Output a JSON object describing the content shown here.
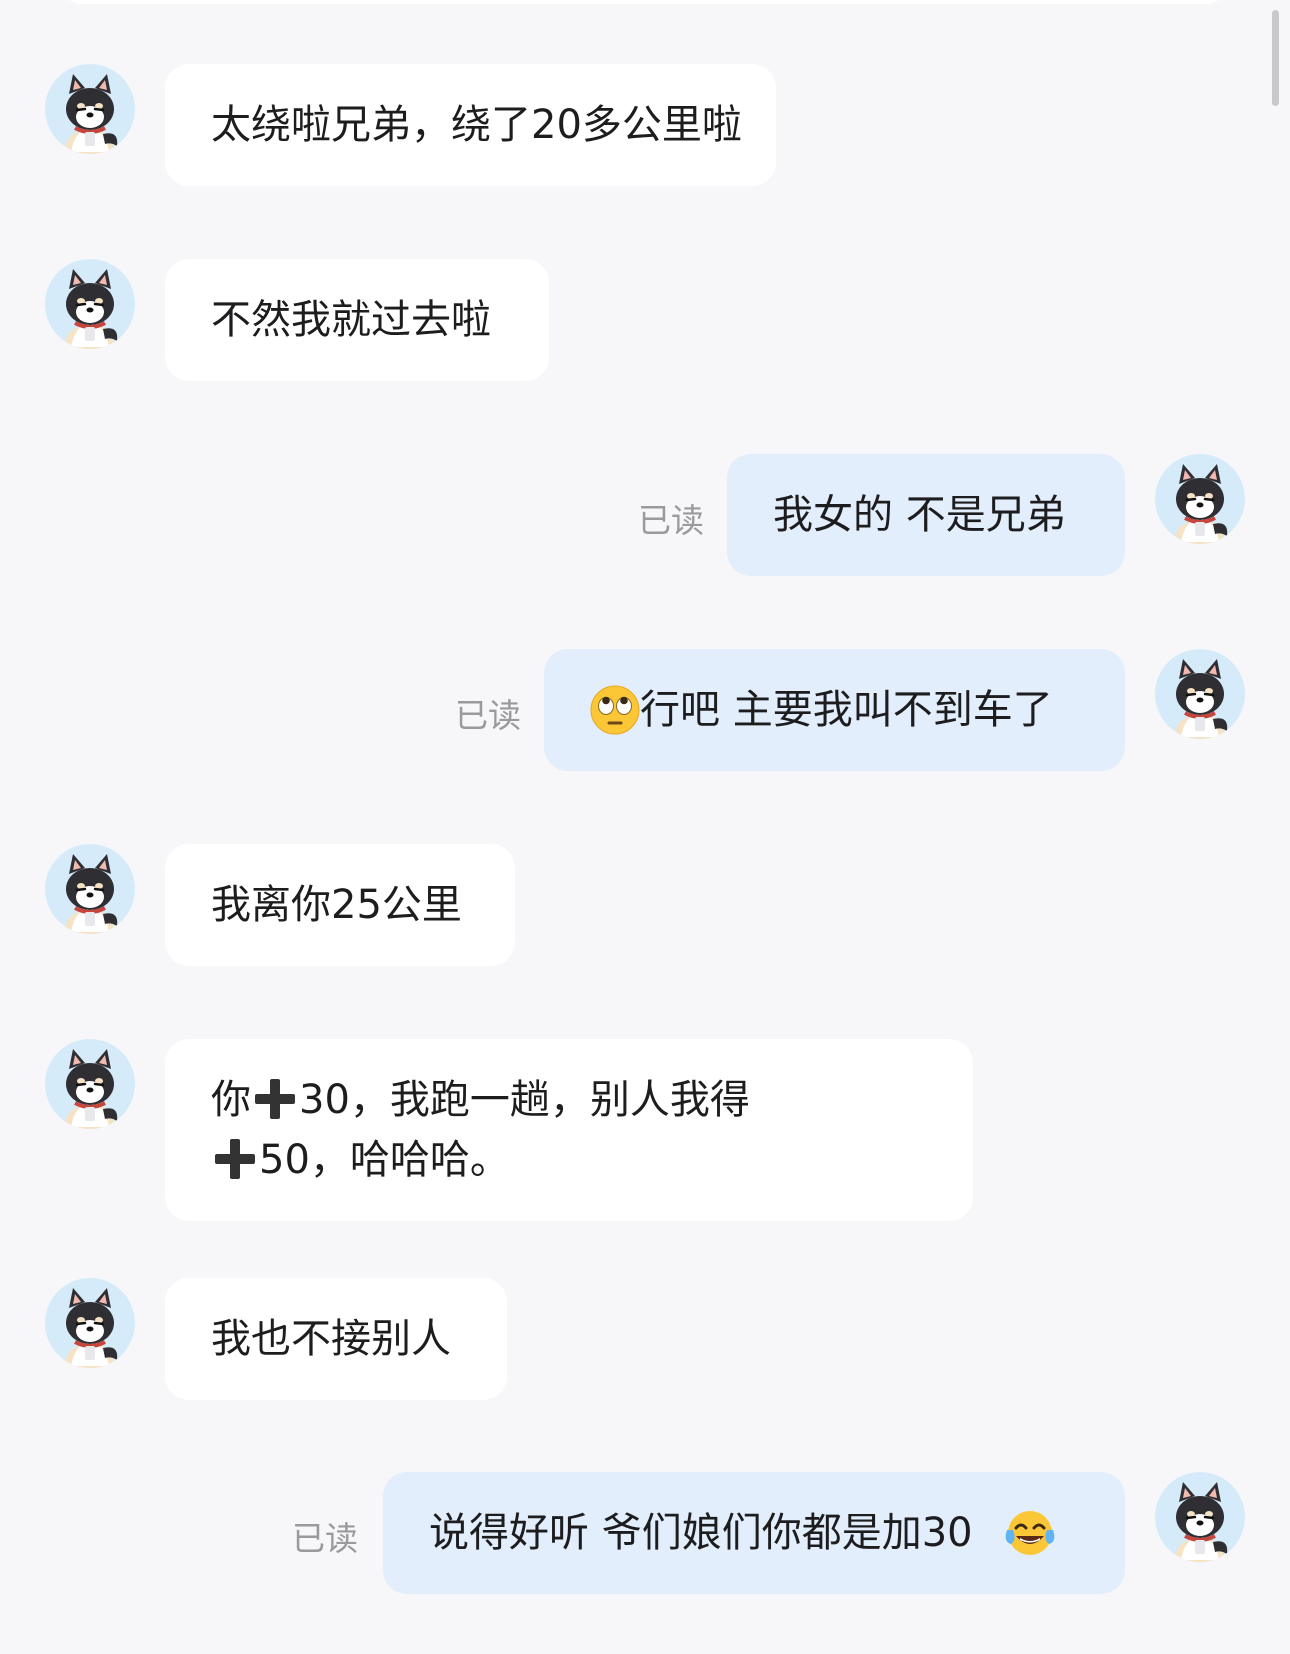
{
  "messages": [
    {
      "side": "left",
      "text": "太绕啦兄弟，绕了20多公里啦"
    },
    {
      "side": "left",
      "text": "不然我就过去啦"
    },
    {
      "side": "right",
      "text": "我女的 不是兄弟",
      "status": "已读"
    },
    {
      "side": "right",
      "text": "行吧 主要我叫不到车了",
      "status": "已读",
      "emoji": "eye-roll-emoji"
    },
    {
      "side": "left",
      "text": "我离你25公里"
    },
    {
      "side": "left",
      "line1a": "你",
      "line1b": "30，我跑一趟，别人我得",
      "line2": "50，哈哈哈。"
    },
    {
      "side": "left",
      "text": "我也不接别人"
    },
    {
      "side": "right",
      "text": "说得好听 爷们娘们你都是加30",
      "status": "已读",
      "emoji": "tears-of-joy-emoji"
    }
  ],
  "colors": {
    "background": "#f7f7f9",
    "incoming_bubble": "#ffffff",
    "outgoing_bubble": "#e3eefc",
    "avatar_bg": "#d6ebfa",
    "read_status": "#9a9a9e"
  },
  "icons": {
    "avatar": "shiba-dog-avatar-icon",
    "plus": "heavy-plus-icon"
  }
}
